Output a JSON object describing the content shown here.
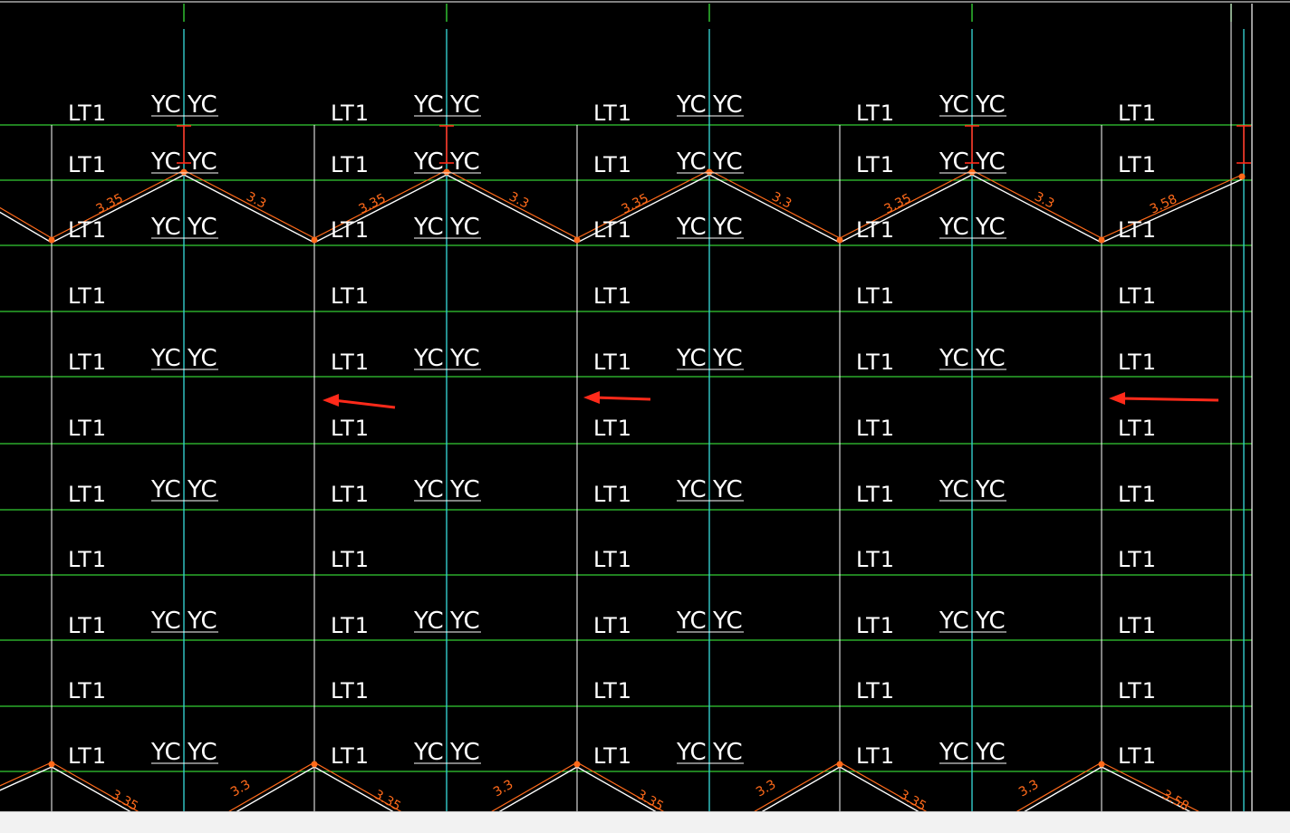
{
  "colors": {
    "background": "#000000",
    "grid_green": "#33cc33",
    "axis_cyan": "#33cccc",
    "dimension_orange": "#ff6a1a",
    "marker_red": "#ff2a1a",
    "line_white": "#ffffff"
  },
  "labels": {
    "wall_mark": "LT1",
    "column_mark_left": "YC",
    "column_mark_right": "YC"
  },
  "dimensions": {
    "top_left_segment": "3.35",
    "top_right_segment": "3.3",
    "top_last_segment": "3.58",
    "bottom_left_segment": "3.35",
    "bottom_right_segment": "3.3",
    "bottom_last_segment": "3.58"
  },
  "annotations": {
    "arrow_count": 3,
    "arrow_direction": "left"
  }
}
